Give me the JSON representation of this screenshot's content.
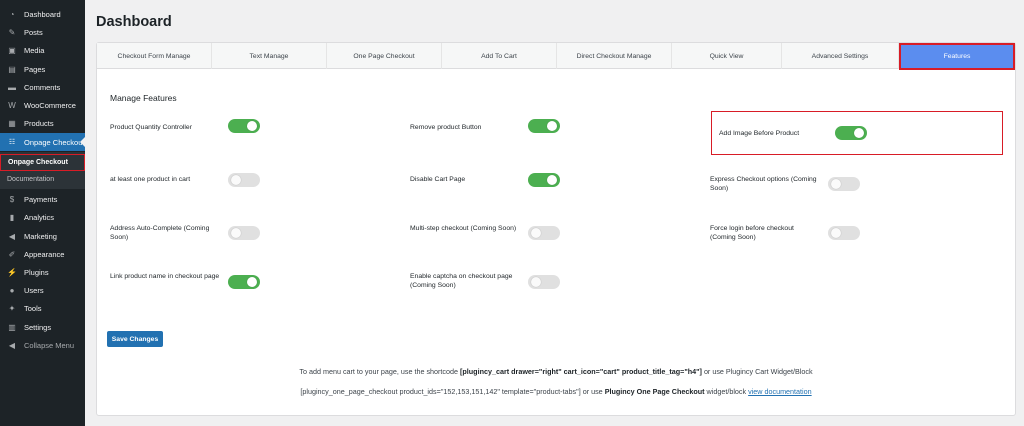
{
  "sidebar": {
    "items": [
      {
        "label": "Dashboard",
        "icon": "dashboard-icon",
        "glyph": "◔"
      },
      {
        "label": "Posts",
        "icon": "pin-icon",
        "glyph": "✎"
      },
      {
        "label": "Media",
        "icon": "media-icon",
        "glyph": "▣"
      },
      {
        "label": "Pages",
        "icon": "page-icon",
        "glyph": "▤"
      },
      {
        "label": "Comments",
        "icon": "comment-icon",
        "glyph": "▬"
      },
      {
        "label": "WooCommerce",
        "icon": "woo-icon",
        "glyph": "W"
      },
      {
        "label": "Products",
        "icon": "products-icon",
        "glyph": "▦"
      },
      {
        "label": "Onpage Checkout",
        "icon": "cart-icon",
        "glyph": "🛒"
      }
    ],
    "submenu": [
      {
        "label": "Onpage Checkout"
      },
      {
        "label": "Documentation"
      }
    ],
    "items_after": [
      {
        "label": "Payments",
        "icon": "payments-icon",
        "glyph": "$"
      },
      {
        "label": "Analytics",
        "icon": "analytics-icon",
        "glyph": "▮"
      },
      {
        "label": "Marketing",
        "icon": "megaphone-icon",
        "glyph": "◀"
      },
      {
        "label": "Appearance",
        "icon": "brush-icon",
        "glyph": "✐"
      },
      {
        "label": "Plugins",
        "icon": "plugin-icon",
        "glyph": "⚡"
      },
      {
        "label": "Users",
        "icon": "users-icon",
        "glyph": "●"
      },
      {
        "label": "Tools",
        "icon": "wrench-icon",
        "glyph": "✦"
      },
      {
        "label": "Settings",
        "icon": "settings-icon",
        "glyph": "▥"
      },
      {
        "label": "Collapse Menu",
        "icon": "collapse-icon",
        "glyph": "◀"
      }
    ]
  },
  "page": {
    "title": "Dashboard"
  },
  "tabs": [
    {
      "label": "Checkout Form Manage"
    },
    {
      "label": "Text Manage"
    },
    {
      "label": "One Page Checkout"
    },
    {
      "label": "Add To Cart"
    },
    {
      "label": "Direct Checkout Manage"
    },
    {
      "label": "Quick View"
    },
    {
      "label": "Advanced Settings"
    },
    {
      "label": "Features"
    }
  ],
  "section": {
    "title": "Manage Features"
  },
  "features": [
    {
      "label": "Product Quantity Controller",
      "enabled": true
    },
    {
      "label": "Remove product Button",
      "enabled": true
    },
    {
      "label": "Add Image Before Product",
      "enabled": true
    },
    {
      "label": "at least one product in cart",
      "enabled": false
    },
    {
      "label": "Disable Cart Page",
      "enabled": true
    },
    {
      "label": "Express Checkout options (Coming Soon)",
      "enabled": false
    },
    {
      "label": "Address Auto-Complete (Coming Soon)",
      "enabled": false
    },
    {
      "label": "Multi-step checkout (Coming Soon)",
      "enabled": false
    },
    {
      "label": "Force login before checkout (Coming Soon)",
      "enabled": false
    },
    {
      "label": "Link product name in checkout page",
      "enabled": true
    },
    {
      "label": "Enable captcha on checkout page (Coming Soon)",
      "enabled": false
    }
  ],
  "save_button": "Save Changes",
  "notes": {
    "line1_prefix": "To add menu cart to your page, use the shortcode",
    "line1_code": "[plugincy_cart drawer=\"right\" cart_icon=\"cart\" product_title_tag=\"h4\"]",
    "line1_suffix": "or use Plugincy Cart Widget/Block",
    "line2_code": "[plugincy_one_page_checkout product_ids=\"152,153,151,142\" template=\"product-tabs\"]",
    "line2_mid": "or use",
    "line2_bold": "Plugincy One Page Checkout",
    "line2_after": "widget/block",
    "line2_link": "view documentation"
  },
  "colors": {
    "sidebar_bg": "#1d2327",
    "active_menu": "#2271b1",
    "toggle_on": "#4caf50",
    "active_tab": "#5b8def",
    "highlight": "#d81c26"
  }
}
